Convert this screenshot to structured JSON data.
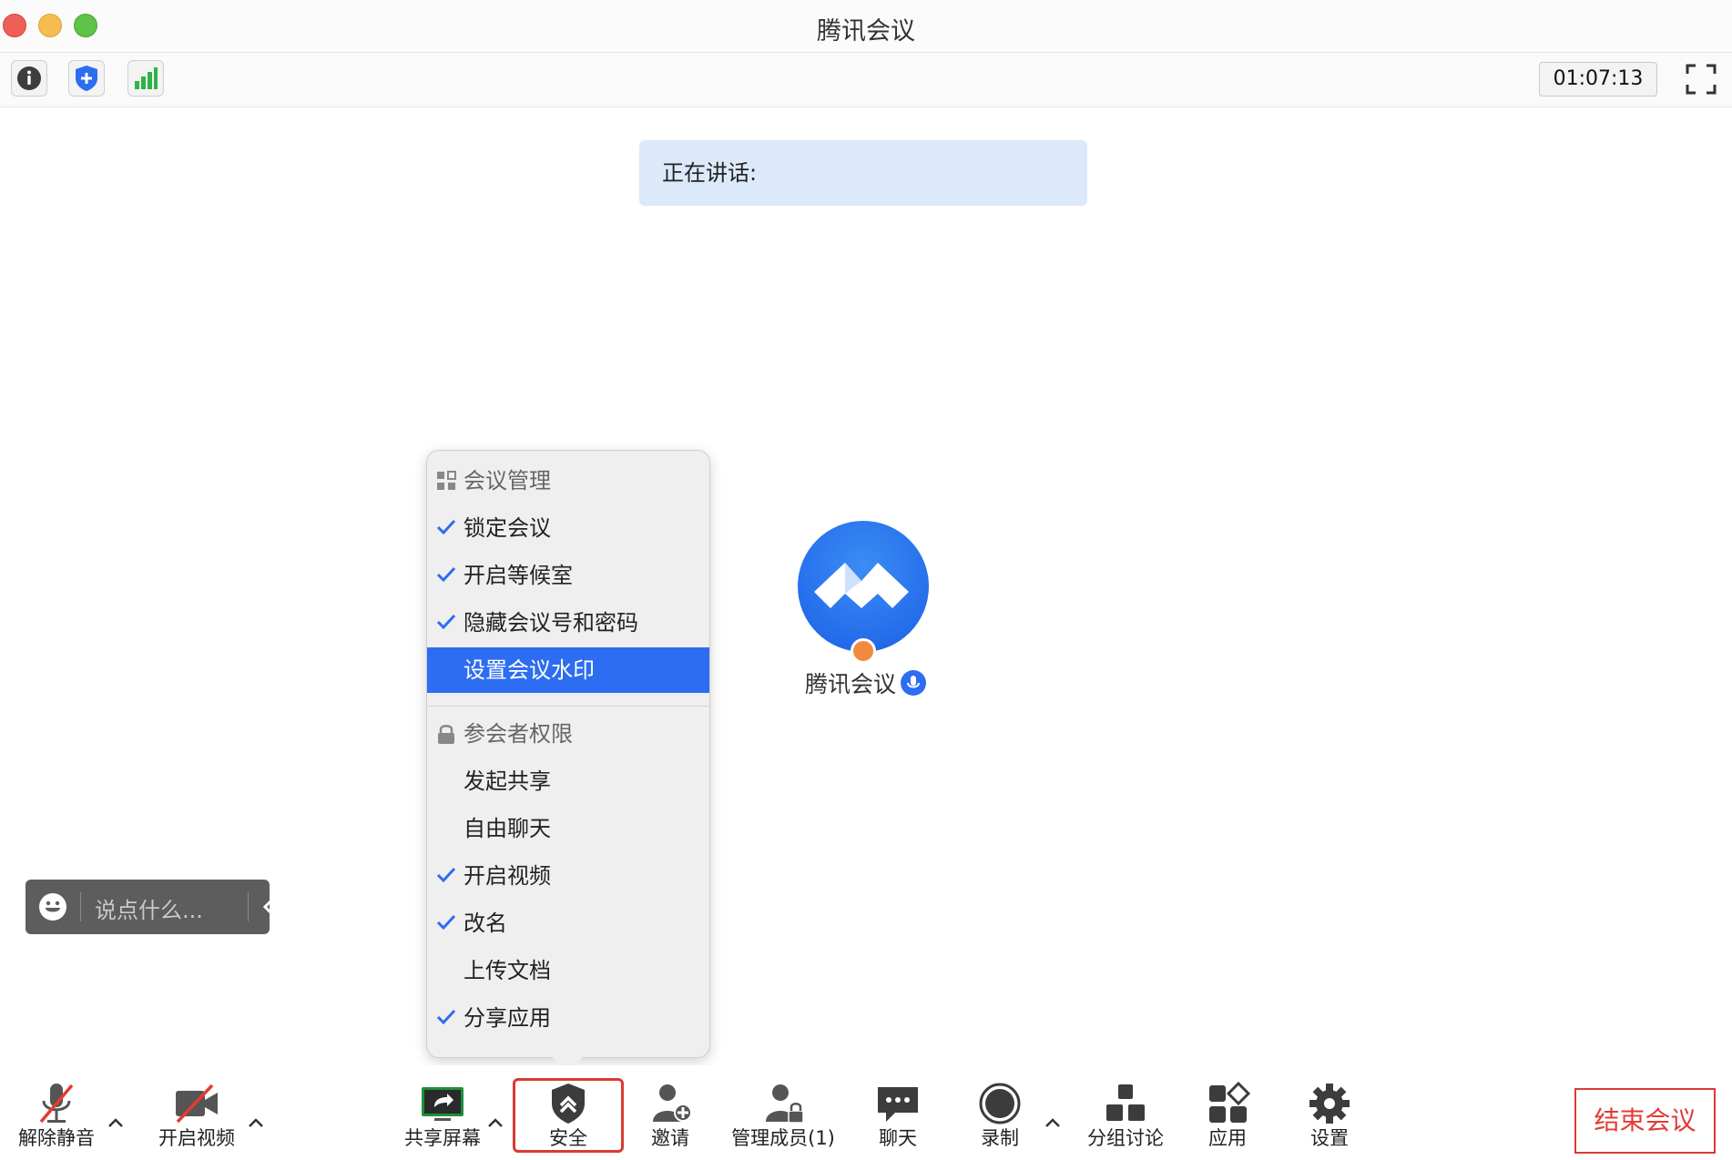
{
  "window": {
    "title": "腾讯会议"
  },
  "toolbar": {
    "timer": "01:07:13"
  },
  "speaking": {
    "label": "正在讲话:"
  },
  "participant": {
    "name": "腾讯会议"
  },
  "chat": {
    "placeholder": "说点什么..."
  },
  "menu": {
    "section_meeting": "会议管理",
    "items_meeting": [
      {
        "label": "锁定会议",
        "checked": true
      },
      {
        "label": "开启等候室",
        "checked": true
      },
      {
        "label": "隐藏会议号和密码",
        "checked": true
      },
      {
        "label": "设置会议水印",
        "checked": false,
        "selected": true
      }
    ],
    "section_perm": "参会者权限",
    "items_perm": [
      {
        "label": "发起共享",
        "checked": false
      },
      {
        "label": "自由聊天",
        "checked": false
      },
      {
        "label": "开启视频",
        "checked": true
      },
      {
        "label": "改名",
        "checked": true
      },
      {
        "label": "上传文档",
        "checked": false
      },
      {
        "label": "分享应用",
        "checked": true
      }
    ]
  },
  "bottombar": {
    "unmute": "解除静音",
    "start_video": "开启视频",
    "share_screen": "共享屏幕",
    "security": "安全",
    "invite": "邀请",
    "manage_members": "管理成员(1)",
    "chat": "聊天",
    "record": "录制",
    "breakout": "分组讨论",
    "apps": "应用",
    "settings": "设置",
    "end_meeting": "结束会议"
  },
  "colors": {
    "accent": "#2d6df1",
    "danger": "#e23b35",
    "banner": "#dce9fb",
    "signal": "#2fb24a"
  }
}
